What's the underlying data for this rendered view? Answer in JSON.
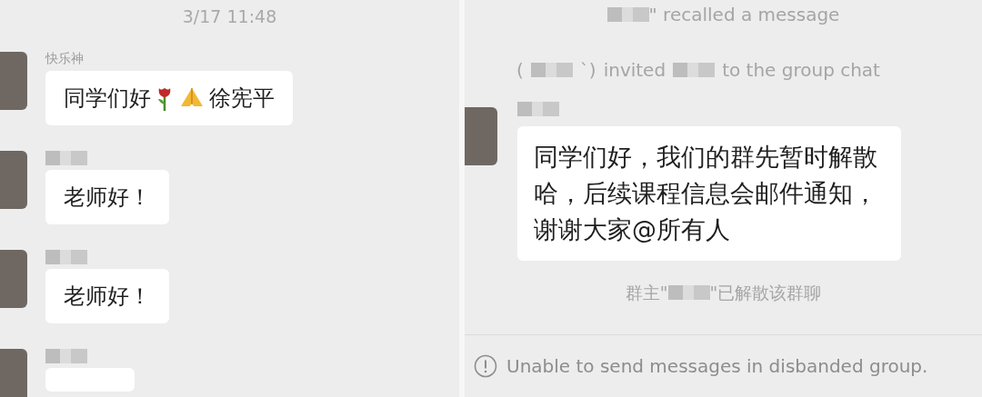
{
  "left_chat": {
    "timestamp": "3/17 11:48",
    "messages": [
      {
        "sender": "快乐神",
        "sender_redacted": false,
        "parts": [
          {
            "kind": "text",
            "text": "同学们好"
          },
          {
            "kind": "emoji"
          },
          {
            "kind": "emoji"
          },
          {
            "kind": "text",
            "text": "徐宪平"
          }
        ]
      },
      {
        "sender_redacted": true,
        "parts": [
          {
            "kind": "text",
            "text": "老师好！"
          }
        ]
      },
      {
        "sender_redacted": true,
        "parts": [
          {
            "kind": "text",
            "text": "老师好！"
          }
        ]
      },
      {
        "sender_redacted": true
      }
    ]
  },
  "right_chat": {
    "notices_top": [
      {
        "segments": [
          {
            "kind": "redacted"
          },
          {
            "kind": "text",
            "text": "\" recalled a message"
          }
        ]
      },
      {
        "segments": [
          {
            "kind": "text",
            "text": "("
          },
          {
            "kind": "redacted"
          },
          {
            "kind": "text",
            "text": "`)"
          },
          {
            "kind": "text",
            "text": "invited"
          },
          {
            "kind": "redacted"
          },
          {
            "kind": "text",
            "text": "to the group chat"
          }
        ]
      }
    ],
    "message": {
      "sender_redacted": true,
      "text": "同学们好，我们的群先暂时解散哈，后续课程信息会邮件通知，谢谢大家@所有人"
    },
    "notice_bottom": {
      "segments": [
        {
          "kind": "text",
          "text": "群主\""
        },
        {
          "kind": "redacted"
        },
        {
          "kind": "text",
          "text": "\"已解散该群聊"
        }
      ]
    },
    "footer": {
      "text": "Unable to send messages in disbanded group."
    }
  }
}
